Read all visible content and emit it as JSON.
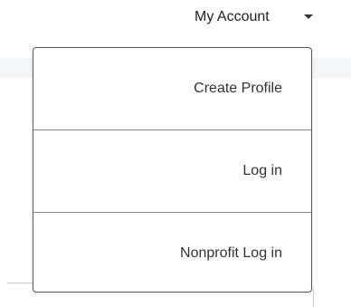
{
  "header": {
    "account_label": "My Account",
    "caret_icon": "caret-down-icon"
  },
  "menu": {
    "items": [
      {
        "label": "Create Profile"
      },
      {
        "label": "Log in"
      },
      {
        "label": "Nonprofit Log in"
      }
    ]
  },
  "colors": {
    "text": "#333333",
    "border": "#5a5a5a",
    "divider": "#8a8a8a",
    "background_band": "#f5f6f7"
  }
}
